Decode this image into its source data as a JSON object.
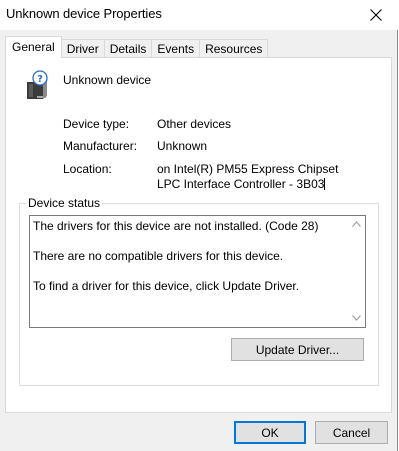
{
  "window": {
    "title": "Unknown device Properties"
  },
  "tabs": [
    {
      "label": "General",
      "active": true
    },
    {
      "label": "Driver",
      "active": false
    },
    {
      "label": "Details",
      "active": false
    },
    {
      "label": "Events",
      "active": false
    },
    {
      "label": "Resources",
      "active": false
    }
  ],
  "general": {
    "device_name": "Unknown device",
    "device_icon": "unknown-device-icon",
    "properties": {
      "device_type_label": "Device type:",
      "device_type_value": "Other devices",
      "manufacturer_label": "Manufacturer:",
      "manufacturer_value": "Unknown",
      "location_label": "Location:",
      "location_value": "on Intel(R) PM55 Express Chipset LPC Interface Controller - 3B03"
    },
    "device_status": {
      "legend": "Device status",
      "text": "The drivers for this device are not installed. (Code 28)\n\nThere are no compatible drivers for this device.\n\nTo find a driver for this device, click Update Driver."
    },
    "update_driver_label": "Update Driver..."
  },
  "footer": {
    "ok_label": "OK",
    "cancel_label": "Cancel"
  },
  "colors": {
    "window_bg": "#f0f0f0",
    "panel_bg": "#ffffff",
    "ok_focus_border": "#0078d7",
    "button_bg": "#e1e1e1"
  }
}
